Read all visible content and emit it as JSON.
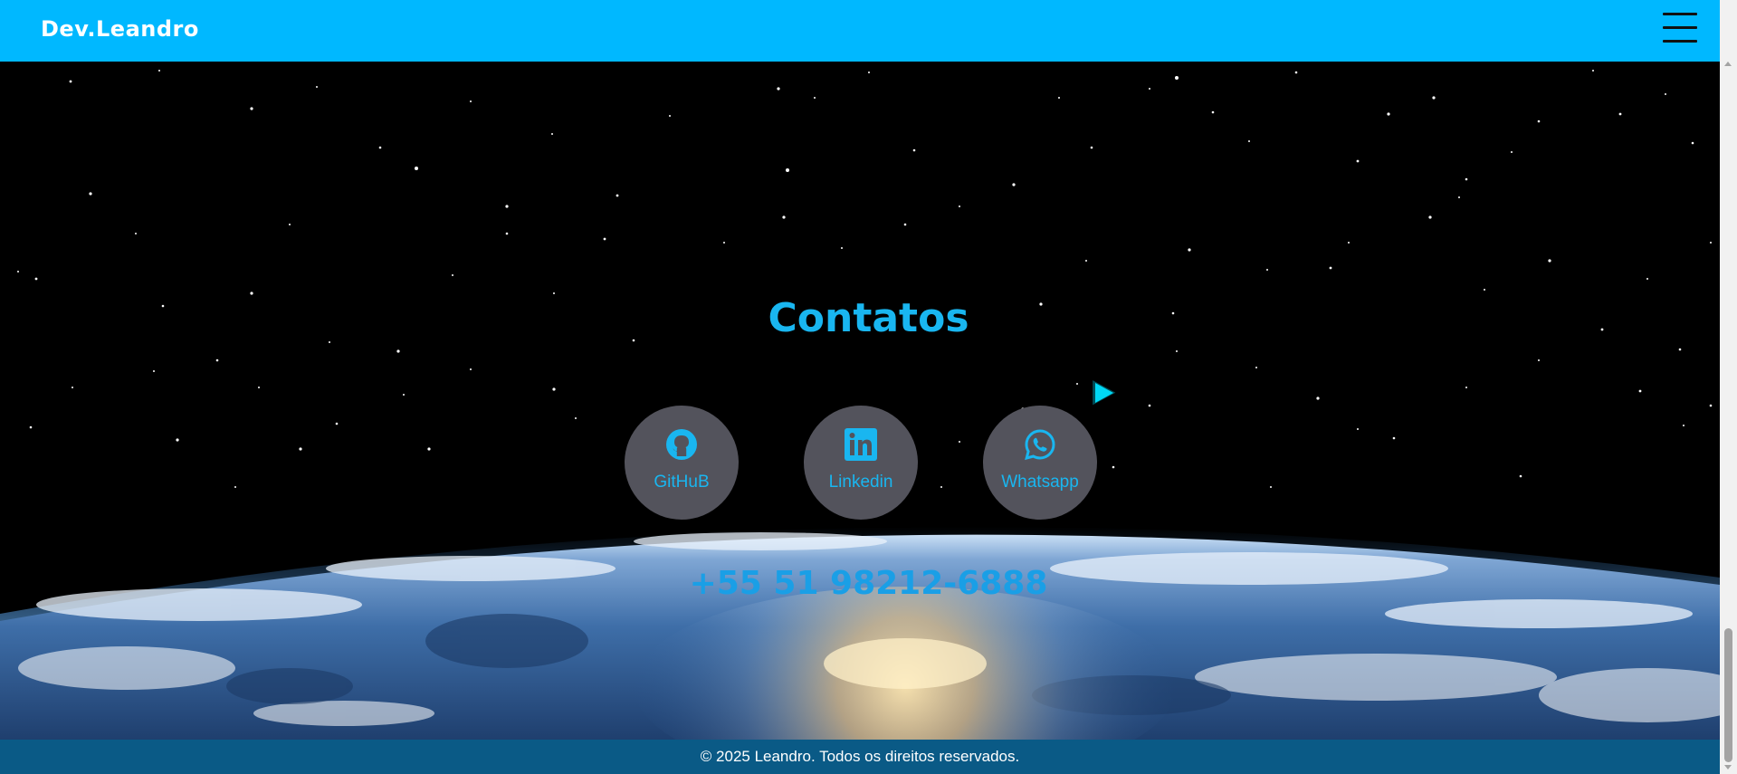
{
  "header": {
    "brand": "Dev.Leandro",
    "menu_icon": "hamburger-menu-icon"
  },
  "contact": {
    "title": "Contatos",
    "links": [
      {
        "label": "GitHuB",
        "icon": "github-icon"
      },
      {
        "label": "Linkedin",
        "icon": "linkedin-icon"
      },
      {
        "label": "Whatsapp",
        "icon": "whatsapp-icon"
      }
    ],
    "phone": "+55 51 98212-6888"
  },
  "footer": {
    "text": "© 2025 Leandro. Todos os direitos reservados."
  },
  "colors": {
    "header_bg": "#00b8ff",
    "accent": "#19b6f0",
    "button_bg": "#53535c",
    "footer_bg": "#0a5a86"
  }
}
